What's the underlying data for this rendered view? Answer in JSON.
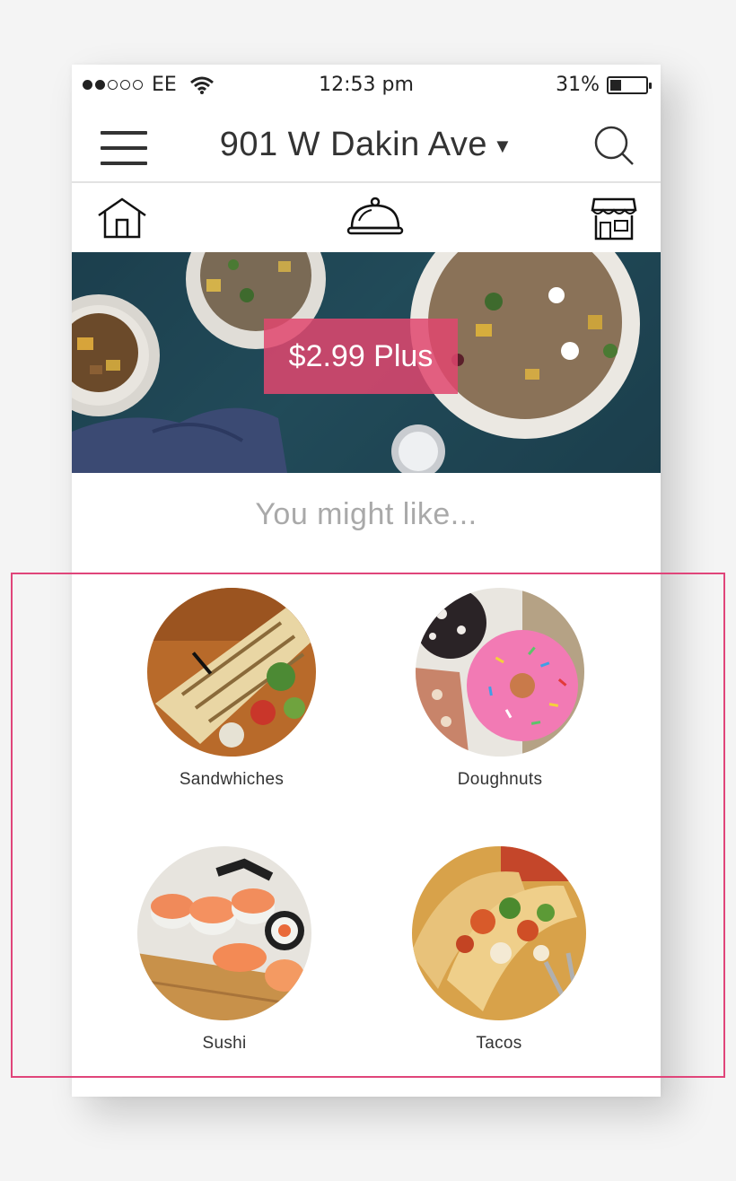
{
  "status_bar": {
    "carrier": "EE",
    "time": "12:53 pm",
    "battery": "31%",
    "battery_level": 0.31,
    "signal_bars": 2
  },
  "header": {
    "address": "901 W Dakin Ave",
    "menu_icon": "hamburger-menu-icon",
    "search_icon": "search-icon"
  },
  "nav": {
    "icons": [
      "home-icon",
      "cloche-icon",
      "store-icon"
    ]
  },
  "promo": {
    "label": "$2.99 Plus"
  },
  "section": {
    "title": "You might like..."
  },
  "categories": [
    {
      "label": "Sandwhiches"
    },
    {
      "label": "Doughnuts"
    },
    {
      "label": "Sushi"
    },
    {
      "label": "Tacos"
    }
  ],
  "colors": {
    "accent": "#e0457a",
    "promo_bg": "#e0476e",
    "text_dark": "#333333",
    "text_muted": "#a9a9a9"
  }
}
